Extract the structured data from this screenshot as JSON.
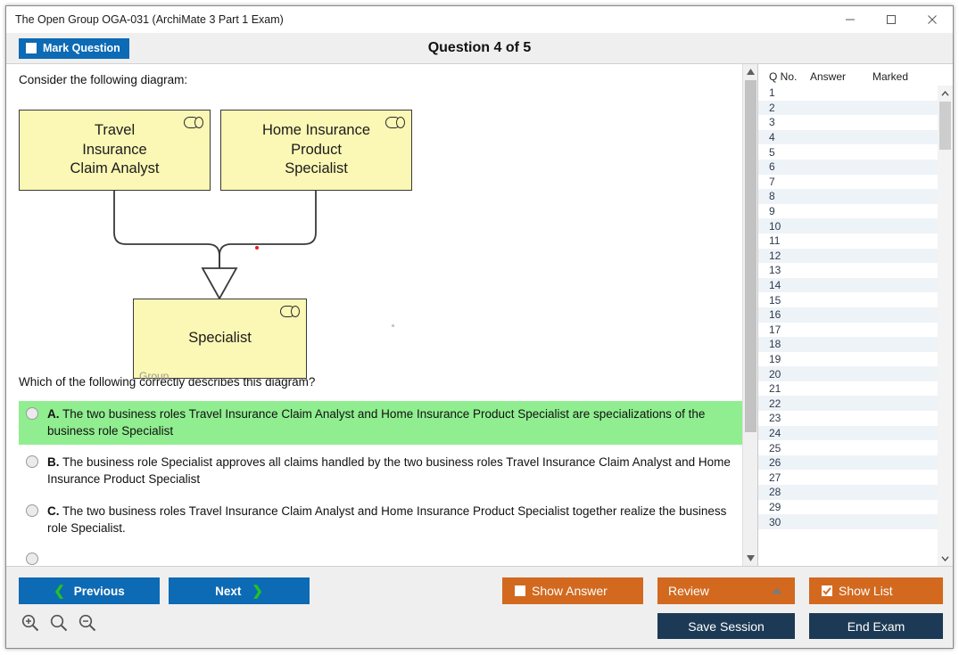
{
  "window": {
    "title": "The Open Group OGA-031 (ArchiMate 3 Part 1 Exam)",
    "minimize_label": "—",
    "maximize_label": "□",
    "close_label": "✕"
  },
  "header": {
    "mark_question_label": "Mark Question",
    "mark_question_checked": false,
    "question_counter": "Question 4 of 5"
  },
  "question": {
    "intro": "Consider the following diagram:",
    "prompt": "Which of the following correctly describes this diagram?",
    "options": [
      {
        "letter": "A.",
        "text": "The two business roles Travel Insurance Claim Analyst and Home Insurance Product Specialist are specializations of the business role Specialist",
        "selected": false,
        "correct": true
      },
      {
        "letter": "B.",
        "text": "The business role Specialist approves all claims handled by the two business roles Travel Insurance Claim Analyst and Home Insurance Product Specialist",
        "selected": false,
        "correct": false
      },
      {
        "letter": "C.",
        "text": "The two business roles Travel Insurance Claim Analyst and Home Insurance Product Specialist together realize the business role Specialist.",
        "selected": false,
        "correct": false
      }
    ]
  },
  "diagram": {
    "notation": "ArchiMate",
    "relationship": "specialization",
    "group_label": "Group",
    "nodes": [
      {
        "id": "travel",
        "label": "Travel\nInsurance\nClaim Analyst",
        "type": "business-role"
      },
      {
        "id": "home",
        "label": "Home Insurance\nProduct\nSpecialist",
        "type": "business-role"
      },
      {
        "id": "specialist",
        "label": "Specialist",
        "type": "business-role"
      }
    ]
  },
  "list_panel": {
    "columns": [
      "Q No.",
      "Answer",
      "Marked"
    ],
    "rows": [
      {
        "qno": "1",
        "answer": "",
        "marked": ""
      },
      {
        "qno": "2",
        "answer": "",
        "marked": ""
      },
      {
        "qno": "3",
        "answer": "",
        "marked": ""
      },
      {
        "qno": "4",
        "answer": "",
        "marked": ""
      },
      {
        "qno": "5",
        "answer": "",
        "marked": ""
      },
      {
        "qno": "6",
        "answer": "",
        "marked": ""
      },
      {
        "qno": "7",
        "answer": "",
        "marked": ""
      },
      {
        "qno": "8",
        "answer": "",
        "marked": ""
      },
      {
        "qno": "9",
        "answer": "",
        "marked": ""
      },
      {
        "qno": "10",
        "answer": "",
        "marked": ""
      },
      {
        "qno": "11",
        "answer": "",
        "marked": ""
      },
      {
        "qno": "12",
        "answer": "",
        "marked": ""
      },
      {
        "qno": "13",
        "answer": "",
        "marked": ""
      },
      {
        "qno": "14",
        "answer": "",
        "marked": ""
      },
      {
        "qno": "15",
        "answer": "",
        "marked": ""
      },
      {
        "qno": "16",
        "answer": "",
        "marked": ""
      },
      {
        "qno": "17",
        "answer": "",
        "marked": ""
      },
      {
        "qno": "18",
        "answer": "",
        "marked": ""
      },
      {
        "qno": "19",
        "answer": "",
        "marked": ""
      },
      {
        "qno": "20",
        "answer": "",
        "marked": ""
      },
      {
        "qno": "21",
        "answer": "",
        "marked": ""
      },
      {
        "qno": "22",
        "answer": "",
        "marked": ""
      },
      {
        "qno": "23",
        "answer": "",
        "marked": ""
      },
      {
        "qno": "24",
        "answer": "",
        "marked": ""
      },
      {
        "qno": "25",
        "answer": "",
        "marked": ""
      },
      {
        "qno": "26",
        "answer": "",
        "marked": ""
      },
      {
        "qno": "27",
        "answer": "",
        "marked": ""
      },
      {
        "qno": "28",
        "answer": "",
        "marked": ""
      },
      {
        "qno": "29",
        "answer": "",
        "marked": ""
      },
      {
        "qno": "30",
        "answer": "",
        "marked": ""
      }
    ]
  },
  "footer": {
    "previous_label": "Previous",
    "next_label": "Next",
    "show_answer_label": "Show Answer",
    "show_answer_checked": false,
    "review_label": "Review",
    "show_list_label": "Show List",
    "show_list_checked": true,
    "save_session_label": "Save Session",
    "end_exam_label": "End Exam",
    "zoom_in_icon": "zoom-in-icon",
    "zoom_reset_icon": "zoom-reset-icon",
    "zoom_out_icon": "zoom-out-icon"
  },
  "colors": {
    "accent_blue": "#0d6ab4",
    "accent_orange": "#d2691e",
    "navy": "#1c3a55",
    "correct_highlight": "#90ee90",
    "archimate_fill": "#fbf7b5",
    "chevron_green": "#22c322"
  }
}
